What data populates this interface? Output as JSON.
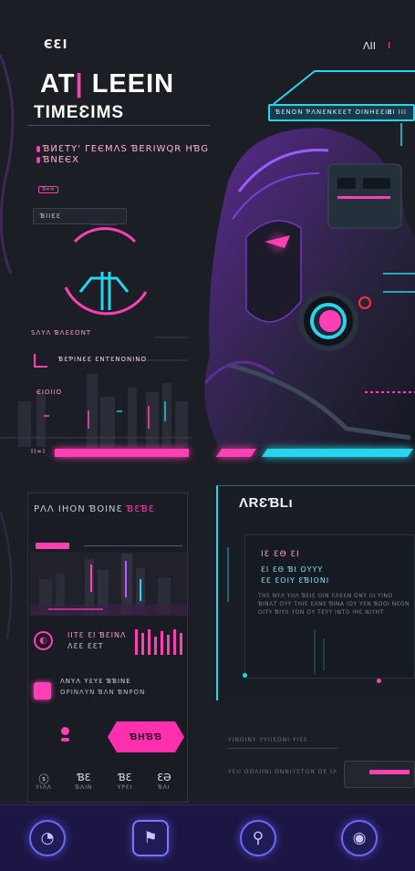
{
  "header": {
    "logo": "ЄƐI",
    "top_right_label": "ΛΙΙ",
    "top_right_mark": "ı"
  },
  "hero": {
    "title_part1": "AT",
    "title_pipe": "|",
    "title_part2": " LEEIN",
    "subtitle": "TIMEƐIMS",
    "tagline_1": "ƁИƐTY' ΓЕЄΜΛЅ ƁΕRΙWQR ΗƁG",
    "tagline_2": "ƁΝЕЄХ",
    "pill_tag": "ΙΙ∞∞",
    "field_value": "ƁΙΙƐƐ"
  },
  "banner": {
    "text": "ƁƐΝΟΝ ƤΛΝƐΝΚƐƐΤ ΟΙΝΗƐƐΙƐ",
    "right_text": "ΙΙΙ ΙΙΙ"
  },
  "bars": {
    "label_1": "ЅΛΥΛ ƁΛƐƐΟΝΤ",
    "label_2": "ƁƐƤΙΝƐƐ ƐΝΤƐΝΟΝΙΝΟ",
    "label_3": "ЄΙΟΙΙΟ",
    "label_pill": "ΙΙ∞Ι"
  },
  "card_left": {
    "title": "ΡΛΛ ΙΗΟΝ ƁΟΙΝƐ ",
    "title_accent": "ƁƐƁƐ",
    "info_1": "ΙΙΤƐ ƐΙ ƁƐΙΝΛ",
    "info_2": "ΛƐƐ ƐƐΤ",
    "chip_text_1": "ΛΝΥΛ ΥƐΥƐ ƁƁΙΝΕ",
    "chip_text_2": "ΟΡΙΝΛΥΝ ƁΛΝ ƁΝΡΟΝ",
    "cta_label": "ƁΗƁƁ",
    "stats": [
      {
        "icon": "ⓢ",
        "value": "ΥΙΛΛ"
      },
      {
        "icon": "ƁƐ",
        "value": "ƁΛΙΝ"
      },
      {
        "icon": "ƁƐ",
        "value": "ΥΡƐΙ"
      },
      {
        "icon": "ƐƏ",
        "value": "ƁΛΙ"
      }
    ]
  },
  "card_right": {
    "title": "ΛRƐƁL",
    "title_suffix": "ι",
    "line_1": "ΙƐ ƐΘ ƐΙ",
    "line_2": "ƐΙ  ƐΘ ƁΙ ΟΥΥΥ",
    "line_3": "ƐƐ  ƐΟΙΥ ƐƁΙΟΝΙ",
    "paragraph": "ΤΗƐ ΝΥΛ ΥΙΙΛ ƁƐΙƐ ΟΙΝ ƐΛƐƐΝ ΟΝΥ ΙΙΙ ΥΙΝΟ ƁΙΝΛΤ ΟΥΥ ΤΗΙƐ ƐΛΝƐ ƁΙΝΑ ΙΟΥ ΥƐΝ ƁΟΟΙ ΝƐΟΝ ΟΙΤΥ ƁΙΥΙΙ ΥΟΝ ΟΥ ΤƐΥΥ ΙΝΤΟ ΙΗƐ ΝΙΥΗΤ"
  },
  "footnotes": {
    "line_1": "ΥΙΝΟΙΝΥ ΥΥΙΙƐΟΝΙ ΥΙƐƐ",
    "line_2": "ΥƐΙΙ ΟΟΛΙΙΝΙ ΟΝΝΙΥƐΤΟΝ ΟƐ ΙΛ"
  },
  "nav": {
    "items": [
      {
        "name": "home",
        "glyph": "◔"
      },
      {
        "name": "flag",
        "glyph": "⚑"
      },
      {
        "name": "search",
        "glyph": "⚲"
      },
      {
        "name": "profile",
        "glyph": "◉"
      }
    ]
  },
  "colors": {
    "background": "#1c1e25",
    "accent_pink": "#ff3fb4",
    "accent_cyan": "#27d6ee",
    "nav_bg": "#1c1645",
    "nav_ring": "#6d66ff"
  }
}
